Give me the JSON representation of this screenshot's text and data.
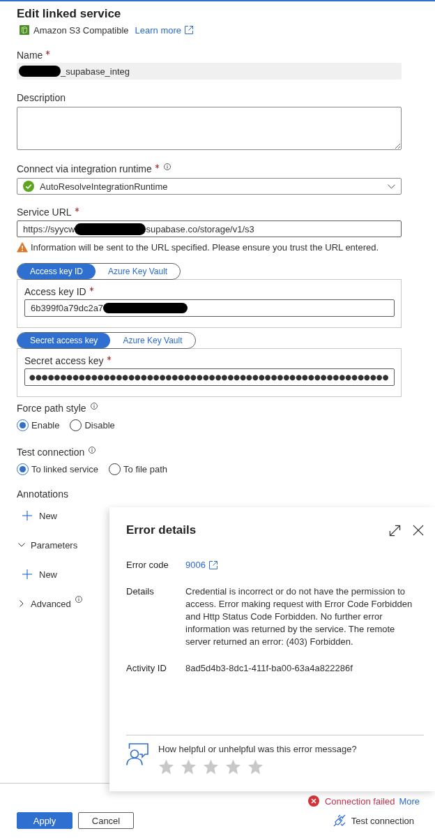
{
  "header": {
    "title": "Edit linked service",
    "service_type": "Amazon S3 Compatible",
    "learn_more": "Learn more"
  },
  "name": {
    "label": "Name",
    "required": true,
    "value": [
      {
        "kind": "redaction"
      },
      {
        "kind": "text",
        "text": "_supabase_integ"
      }
    ]
  },
  "description": {
    "label": "Description"
  },
  "runtime": {
    "label": "Connect via integration runtime",
    "required": true,
    "info": true,
    "value": "AutoResolveIntegrationRuntime"
  },
  "service_url": {
    "label": "Service URL",
    "required": true,
    "value": [
      {
        "kind": "text",
        "text": "https://syycw"
      },
      {
        "kind": "redaction"
      },
      {
        "kind": "text",
        "text": "supabase.co/storage/v1/s3"
      }
    ],
    "warning": "Information will be sent to the URL specified. Please ensure you trust the URL entered."
  },
  "credentials": [
    {
      "kind": "text",
      "tabs": [
        {
          "label": "Access key ID",
          "selected": true
        },
        {
          "label": "Azure Key Vault",
          "selected": false
        }
      ],
      "label": "Access key ID",
      "required": true,
      "value": [
        {
          "kind": "text",
          "text": "6b399f0a79dc2a7"
        },
        {
          "kind": "redaction"
        }
      ]
    },
    {
      "kind": "secret",
      "tabs": [
        {
          "label": "Secret access key",
          "selected": true
        },
        {
          "label": "Azure Key Vault",
          "selected": false
        }
      ],
      "label": "Secret access key",
      "required": true,
      "masked_value": "●●●●●●●●●●●●●●●●●●●●●●●●●●●●●●●●●●●●●●●●●●●●●●●●●●●●●●●●●●"
    }
  ],
  "radio_groups": [
    {
      "label": "Force path style",
      "info": true,
      "options": [
        {
          "label": "Enable",
          "selected": true
        },
        {
          "label": "Disable",
          "selected": false
        }
      ]
    },
    {
      "label": "Test connection",
      "info": true,
      "options": [
        {
          "label": "To linked service",
          "selected": true
        },
        {
          "label": "To file path",
          "selected": false
        }
      ]
    }
  ],
  "annotations": {
    "title": "Annotations",
    "new_label": "New"
  },
  "parameters": {
    "title": "Parameters",
    "expanded": true,
    "new_label": "New"
  },
  "advanced": {
    "title": "Advanced",
    "expanded": false,
    "info": true
  },
  "error_panel": {
    "title": "Error details",
    "rows": [
      {
        "kind": "link",
        "label": "Error code",
        "value": "9006"
      },
      {
        "kind": "text",
        "label": "Details",
        "value": "Credential is incorrect or do not have the permission to access. Error making request with Error Code Forbidden and Http Status Code Forbidden. No further error information was returned by the service. The remote server returned an error: (403) Forbidden."
      },
      {
        "kind": "text",
        "label": "Activity ID",
        "value": "8ad5d4b3-8dc1-411f-ba00-63a4a822286f"
      }
    ],
    "feedback": {
      "question": "How helpful or unhelpful was this error message?",
      "stars": 0
    }
  },
  "status": {
    "kind": "error",
    "message": "Connection failed",
    "more": "More"
  },
  "buttons": [
    {
      "kind": "primary",
      "label": "Apply"
    },
    {
      "kind": "secondary",
      "label": "Cancel"
    }
  ],
  "test_connection": "Test connection"
}
